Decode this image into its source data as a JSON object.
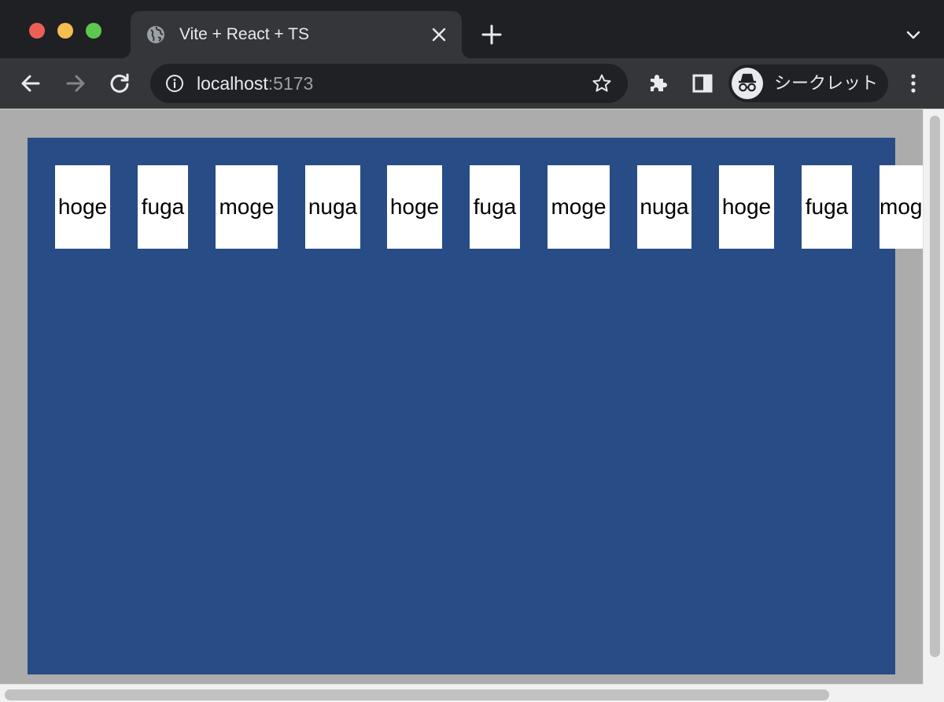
{
  "window": {
    "tab": {
      "title": "Vite + React + TS",
      "favicon": "globe-icon",
      "close_icon": "close-icon"
    },
    "new_tab_icon": "plus-icon",
    "tab_menu_icon": "chevron-down-icon"
  },
  "toolbar": {
    "back_icon": "arrow-left-icon",
    "forward_icon": "arrow-right-icon",
    "reload_icon": "reload-icon",
    "address": {
      "host": "localhost",
      "port": ":5173",
      "info_icon": "info-icon",
      "bookmark_icon": "star-icon"
    },
    "extensions_icon": "puzzle-icon",
    "side_panel_icon": "side-panel-icon",
    "profile": {
      "label": "シークレット",
      "icon": "incognito-icon"
    },
    "menu_icon": "kebab-icon"
  },
  "page": {
    "background": "#284c86",
    "outer_background": "#acacac",
    "cards": [
      "hoge",
      "fuga",
      "moge",
      "nuga",
      "hoge",
      "fuga",
      "moge",
      "nuga",
      "hoge",
      "fuga",
      "moge"
    ]
  }
}
